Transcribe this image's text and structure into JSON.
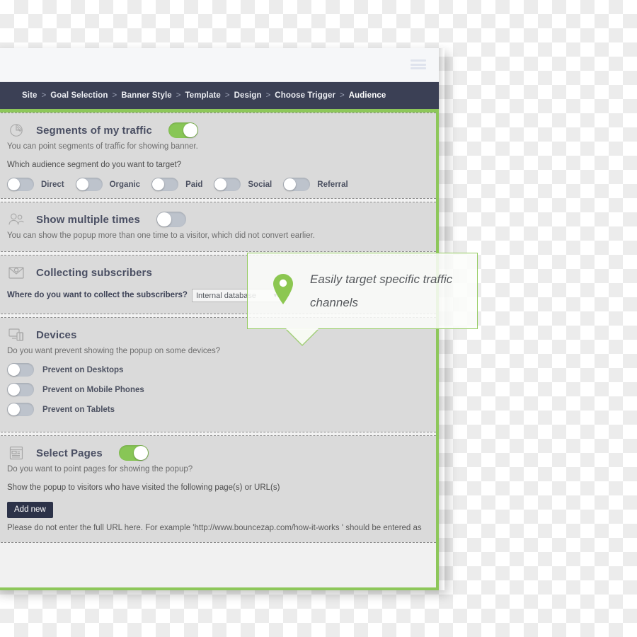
{
  "window": {
    "hamburger_icon": "hamburger-menu-icon"
  },
  "breadcrumb": {
    "separator": ">",
    "items": [
      {
        "label": "Site",
        "active": false
      },
      {
        "label": "Goal Selection",
        "active": false
      },
      {
        "label": "Banner Style",
        "active": false
      },
      {
        "label": "Template",
        "active": false
      },
      {
        "label": "Design",
        "active": false
      },
      {
        "label": "Choose Trigger",
        "active": false
      },
      {
        "label": "Audience",
        "active": true
      }
    ]
  },
  "sections": {
    "segments": {
      "icon": "pie-chart-icon",
      "title": "Segments of my traffic",
      "toggle_state": "on",
      "description": "You can point segments of traffic for showing banner.",
      "question": "Which audience segment do you want to target?",
      "options": [
        {
          "label": "Direct",
          "state": "off"
        },
        {
          "label": "Organic",
          "state": "off"
        },
        {
          "label": "Paid",
          "state": "off"
        },
        {
          "label": "Social",
          "state": "off"
        },
        {
          "label": "Referral",
          "state": "off"
        }
      ]
    },
    "multiple_times": {
      "icon": "users-icon",
      "title": "Show multiple times",
      "toggle_state": "off",
      "description": "You can show the popup more than one time to a visitor, which did not convert earlier."
    },
    "collecting": {
      "icon": "envelope-user-icon",
      "title": "Collecting subscribers",
      "question": "Where do you want to collect the subscribers?",
      "select_value": "Internal database",
      "select_caret": "▼"
    },
    "devices": {
      "icon": "devices-icon",
      "title": "Devices",
      "description": "Do you want prevent showing the popup on some devices?",
      "options": [
        {
          "label": "Prevent on Desktops",
          "state": "off"
        },
        {
          "label": "Prevent on Mobile Phones",
          "state": "off"
        },
        {
          "label": "Prevent on Tablets",
          "state": "off"
        }
      ]
    },
    "select_pages": {
      "icon": "browser-page-icon",
      "title": "Select Pages",
      "toggle_state": "on",
      "description": "Do you want to point pages for showing the popup?",
      "instruction": "Show the popup to visitors who have visited the following page(s) or URL(s)",
      "add_button": "Add new",
      "note": "Please do not enter the full URL here. For example 'http://www.bouncezap.com/how-it-works ' should be entered as"
    }
  },
  "tooltip": {
    "icon": "map-pin-icon",
    "text": "Easily target specific traffic channels"
  },
  "colors": {
    "accent_green": "#8dc75a",
    "toggle_on": "#88c656",
    "toggle_off": "#bdc3cc",
    "breadcrumb_bg": "#3b4055",
    "button_dark": "#2c3248",
    "panel_bg": "#dadada"
  }
}
